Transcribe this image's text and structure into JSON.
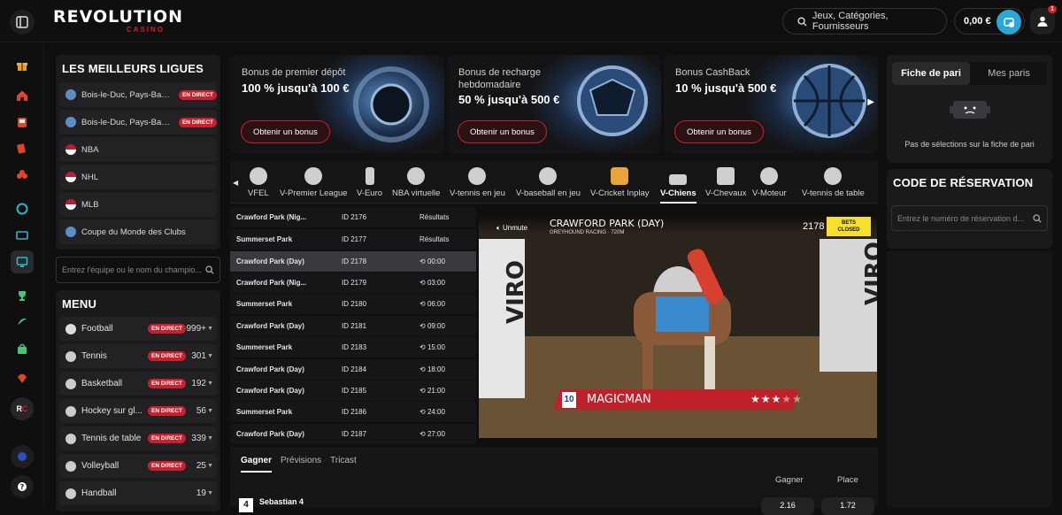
{
  "brand": {
    "name": "REVOLUTION",
    "sub": "CASINO"
  },
  "header": {
    "search_label": "Jeux, Catégories, Fournisseurs",
    "balance": "0,00 €",
    "notifications": "1"
  },
  "leagues": {
    "title": "LES MEILLEURS LIGUES",
    "items": [
      {
        "label": "Bois-le-Duc, Pays-Bas, ...",
        "live": "EN DIRECT"
      },
      {
        "label": "Bois-le-Duc, Pays-Bas, ...",
        "live": "EN DIRECT"
      },
      {
        "label": "NBA",
        "live": ""
      },
      {
        "label": "NHL",
        "live": ""
      },
      {
        "label": "MLB",
        "live": ""
      },
      {
        "label": "Coupe du Monde des Clubs",
        "live": ""
      }
    ],
    "search_placeholder": "Entrez l'équipe ou le nom du champio..."
  },
  "menu": {
    "title": "MENU",
    "sports": [
      {
        "label": "Football",
        "live": "EN DIRECT",
        "count": "999+"
      },
      {
        "label": "Tennis",
        "live": "EN DIRECT",
        "count": "301"
      },
      {
        "label": "Basketball",
        "live": "EN DIRECT",
        "count": "192"
      },
      {
        "label": "Hockey sur gl...",
        "live": "EN DIRECT",
        "count": "56"
      },
      {
        "label": "Tennis de table",
        "live": "EN DIRECT",
        "count": "339"
      },
      {
        "label": "Volleyball",
        "live": "EN DIRECT",
        "count": "25"
      },
      {
        "label": "Handball",
        "live": "",
        "count": "19"
      }
    ]
  },
  "promos": [
    {
      "title": "Bonus de premier dépôt",
      "value": "100 % jusqu'à 100 €",
      "button": "Obtenir un bonus"
    },
    {
      "title": "Bonus de recharge hebdomadaire",
      "value": "50 % jusqu'à 500 €",
      "button": "Obtenir un bonus"
    },
    {
      "title": "Bonus CashBack",
      "value": "10 % jusqu'à 500 €",
      "button": "Obtenir un bonus"
    }
  ],
  "sport_tabs": [
    "VFEL",
    "V-Premier League",
    "V-Euro",
    "NBA virtuelle",
    "V-tennis en jeu",
    "V-baseball en jeu",
    "V-Cricket Inplay",
    "V-Chiens",
    "V-Chevaux",
    "V-Moteur",
    "V-tennis de table"
  ],
  "active_tab": "V-Chiens",
  "races": [
    {
      "venue": "Crawford Park (Nig...",
      "id": "ID 2176",
      "status": "Résultats",
      "timer": false
    },
    {
      "venue": "Summerset Park",
      "id": "ID 2177",
      "status": "Résultats",
      "timer": false
    },
    {
      "venue": "Crawford Park (Day)",
      "id": "ID 2178",
      "status": "00:00",
      "timer": true
    },
    {
      "venue": "Crawford Park (Nig...",
      "id": "ID 2179",
      "status": "03:00",
      "timer": true
    },
    {
      "venue": "Summerset Park",
      "id": "ID 2180",
      "status": "06:00",
      "timer": true
    },
    {
      "venue": "Crawford Park (Day)",
      "id": "ID 2181",
      "status": "09:00",
      "timer": true
    },
    {
      "venue": "Summerset Park",
      "id": "ID 2183",
      "status": "15:00",
      "timer": true
    },
    {
      "venue": "Crawford Park (Day)",
      "id": "ID 2184",
      "status": "18:00",
      "timer": true
    },
    {
      "venue": "Crawford Park (Day)",
      "id": "ID 2185",
      "status": "21:00",
      "timer": true
    },
    {
      "venue": "Summerset Park",
      "id": "ID 2186",
      "status": "24:00",
      "timer": true
    },
    {
      "venue": "Crawford Park (Day)",
      "id": "ID 2187",
      "status": "27:00",
      "timer": true
    }
  ],
  "video": {
    "venue": "CRAWFORD PARK (DAY)",
    "sub": "GREYHOUND RACING · 720M",
    "race_id": "2178",
    "bets_closed": "BETS CLOSED",
    "unmute": "Unmute",
    "runner_number": "10",
    "runner_name": "MAGICMAN",
    "stars_filled": 3,
    "stars_total": 5
  },
  "market": {
    "tabs": [
      "Gagner",
      "Prévisions",
      "Tricast"
    ],
    "col_win": "Gagner",
    "col_place": "Place",
    "runner": "Sebastian 4",
    "runner_number": "4",
    "odds_win": "2.16",
    "odds_place": "1.72"
  },
  "betslip": {
    "tab_active": "Fiche de pari",
    "tab_other": "Mes paris",
    "empty": "Pas de sélections sur la fiche de pari"
  },
  "reservation": {
    "title": "CODE DE RÉSERVATION",
    "placeholder": "Entrez le numéro de réservation d..."
  },
  "colors": {
    "accent": "#c9202e",
    "wallet": "#2aa7d7",
    "bg": "#0f0f10",
    "panel": "#1a1a1c"
  }
}
